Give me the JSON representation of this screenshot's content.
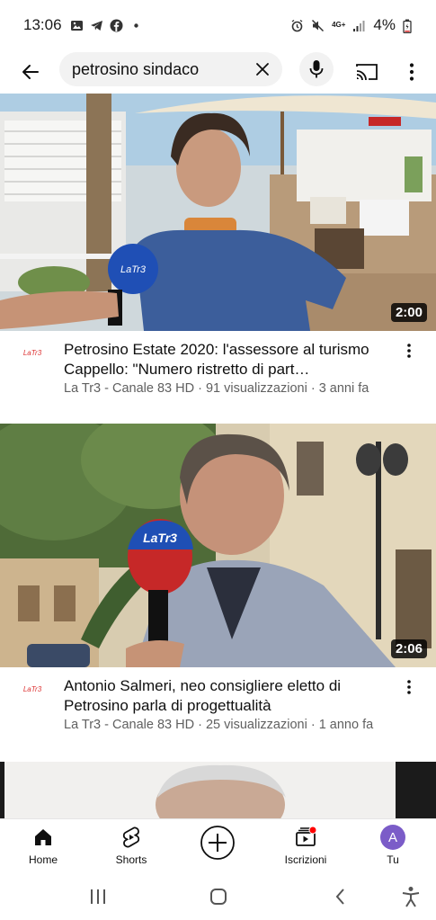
{
  "status_bar": {
    "time": "13:06",
    "network": "4G+",
    "battery": "4%"
  },
  "search": {
    "query": "petrosino sindaco"
  },
  "videos": [
    {
      "title": "Petrosino Estate 2020: l'assessore al turismo Cappello: \"Numero ristretto di part…",
      "channel": "La Tr3 - Canale 83 HD",
      "views": "91 visualizzazioni",
      "age": "3 anni fa",
      "duration": "2:00",
      "channel_logo": "LaTr3"
    },
    {
      "title": "Antonio Salmeri, neo consigliere eletto di Petrosino parla di progettualità",
      "channel": "La Tr3 - Canale 83 HD",
      "views": "25 visualizzazioni",
      "age": "1 anno fa",
      "duration": "2:06",
      "channel_logo": "LaTr3"
    }
  ],
  "bottom_nav": {
    "home": "Home",
    "shorts": "Shorts",
    "subscriptions": "Iscrizioni",
    "you": "Tu",
    "avatar_letter": "A"
  },
  "colors": {
    "accent_red": "#ff0000",
    "avatar_purple": "#7b5cc8",
    "secondary_text": "#606060"
  }
}
